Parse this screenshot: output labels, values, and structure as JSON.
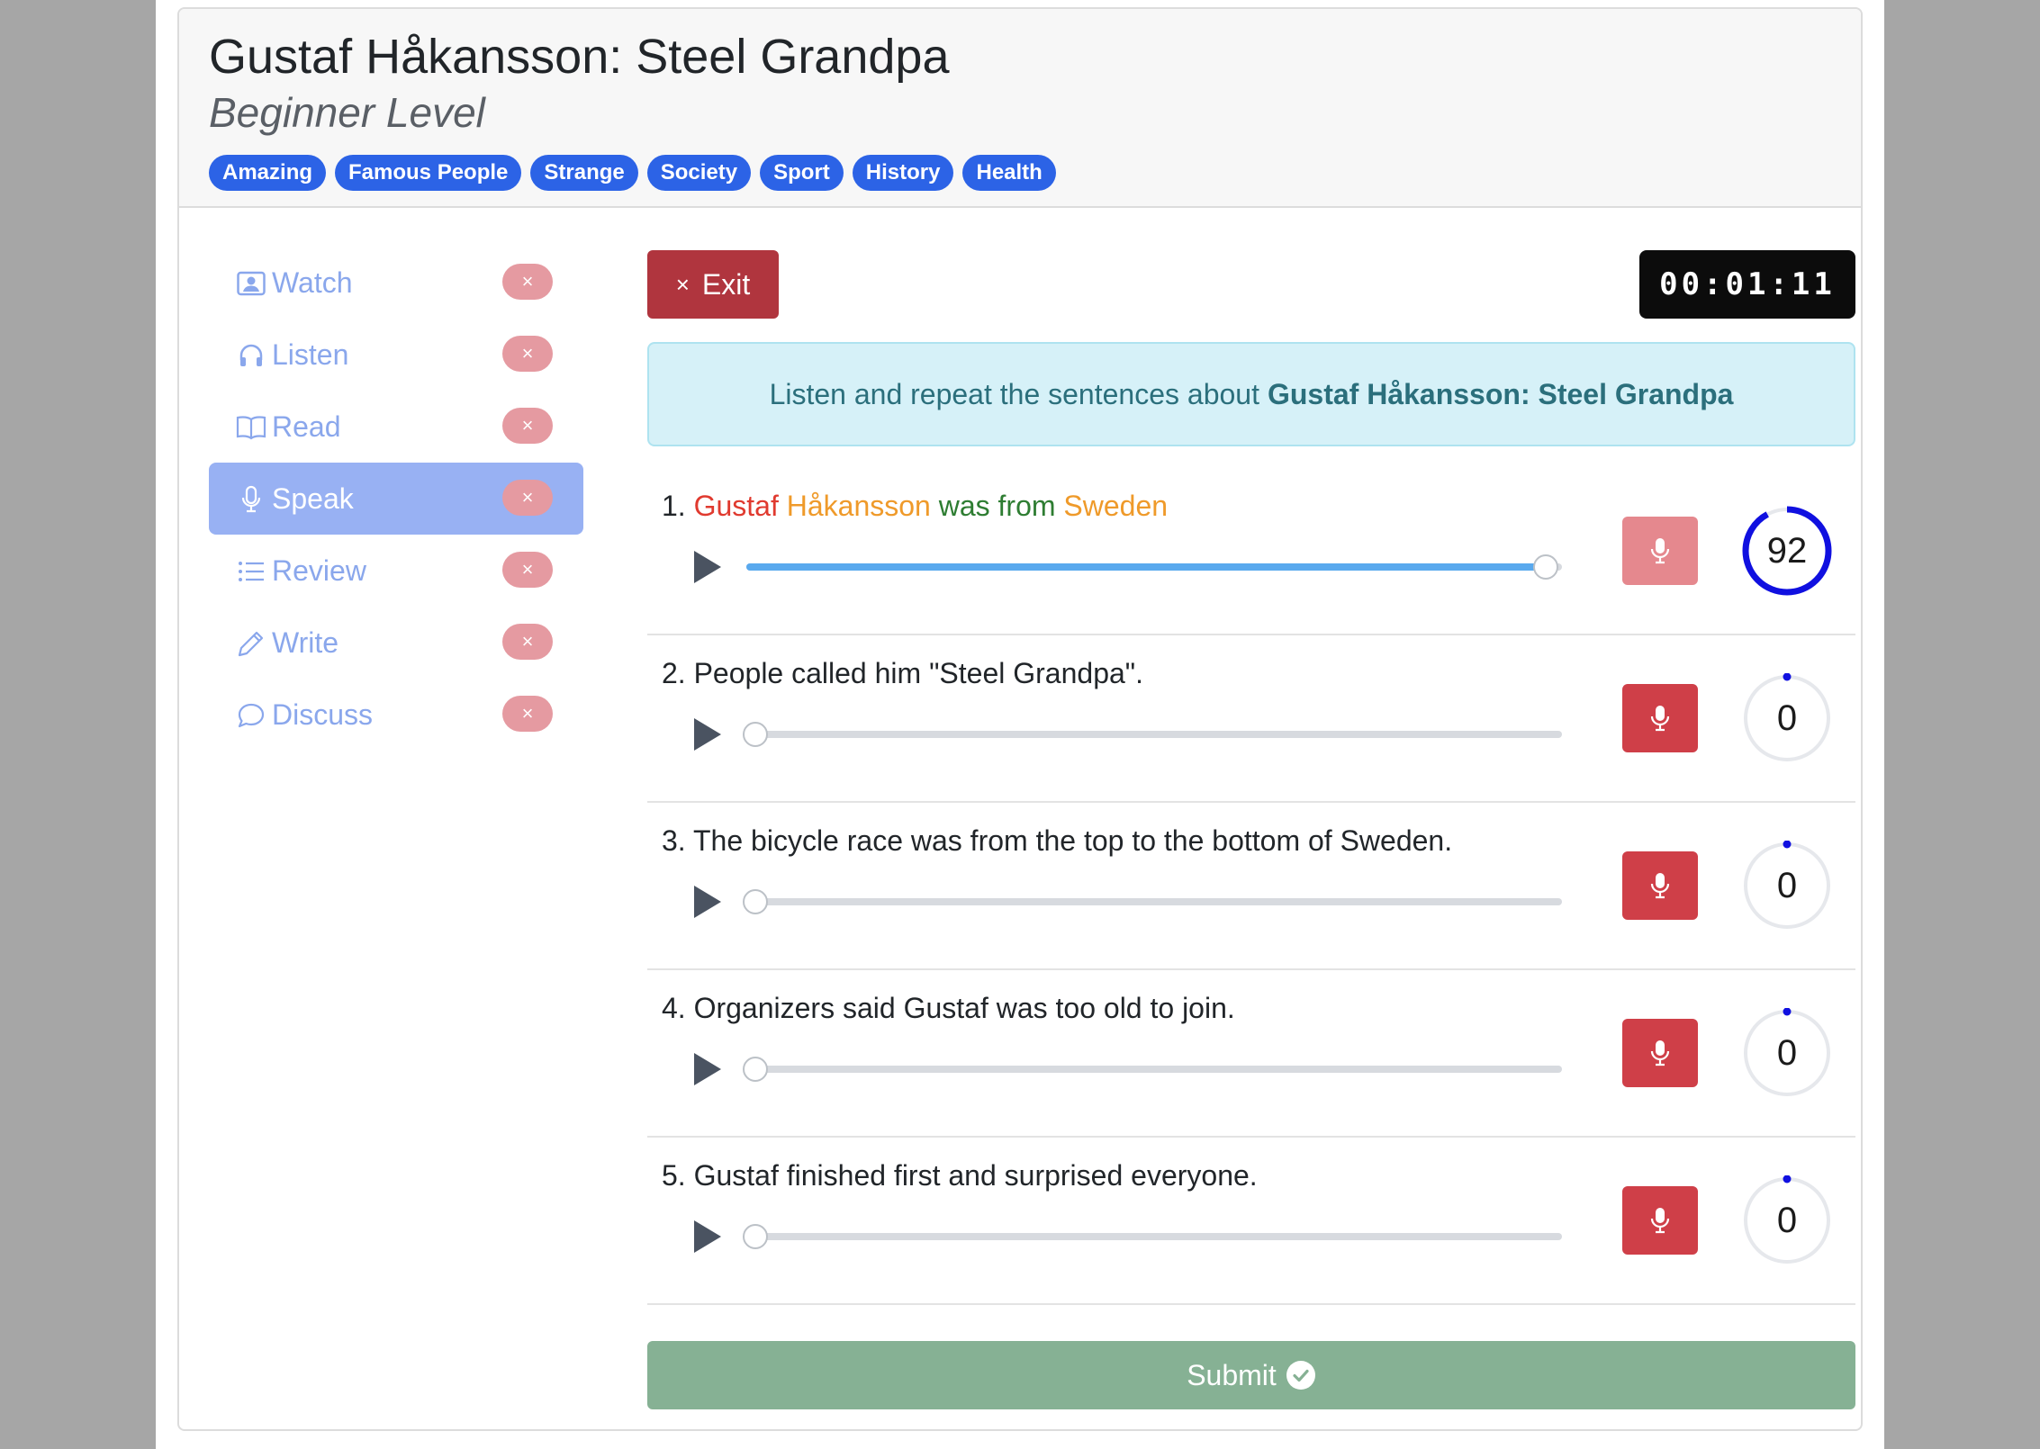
{
  "header": {
    "title": "Gustaf Håkansson: Steel Grandpa",
    "level": "Beginner Level",
    "tags": [
      "Amazing",
      "Famous People",
      "Strange",
      "Society",
      "Sport",
      "History",
      "Health"
    ]
  },
  "sidebar": {
    "items": [
      {
        "label": "Watch",
        "icon": "person-video-icon",
        "badge": "×",
        "active": false
      },
      {
        "label": "Listen",
        "icon": "headphones-icon",
        "badge": "×",
        "active": false
      },
      {
        "label": "Read",
        "icon": "book-icon",
        "badge": "×",
        "active": false
      },
      {
        "label": "Speak",
        "icon": "microphone-icon",
        "badge": "×",
        "active": true
      },
      {
        "label": "Review",
        "icon": "list-icon",
        "badge": "×",
        "active": false
      },
      {
        "label": "Write",
        "icon": "pencil-icon",
        "badge": "×",
        "active": false
      },
      {
        "label": "Discuss",
        "icon": "chat-bubble-icon",
        "badge": "×",
        "active": false
      }
    ]
  },
  "toolbar": {
    "exit_icon": "×",
    "exit_label": "Exit",
    "timer": "00:01:11"
  },
  "instruction": {
    "text": "Listen and repeat the sentences about",
    "topic": "Gustaf Håkansson: Steel Grandpa"
  },
  "sentences": [
    {
      "number": "1.",
      "words": [
        {
          "text": "Gustaf",
          "color": "#e03a2f"
        },
        {
          "text": "Håkansson",
          "color": "#ef9a2a"
        },
        {
          "text": "was",
          "color": "#2e7d32"
        },
        {
          "text": "from",
          "color": "#2e7d32"
        },
        {
          "text": "Sweden",
          "color": "#ef9a2a"
        }
      ],
      "progress": 1.0,
      "score": "92",
      "score_fraction": 0.92,
      "mic_disabled": true
    },
    {
      "number": "2.",
      "text": "People called him \"Steel Grandpa\".",
      "progress": 0,
      "score": "0",
      "score_fraction": 0,
      "mic_disabled": false
    },
    {
      "number": "3.",
      "text": "The bicycle race was from the top to the bottom of Sweden.",
      "progress": 0,
      "score": "0",
      "score_fraction": 0,
      "mic_disabled": false
    },
    {
      "number": "4.",
      "text": "Organizers said Gustaf was too old to join.",
      "progress": 0,
      "score": "0",
      "score_fraction": 0,
      "mic_disabled": false
    },
    {
      "number": "5.",
      "text": "Gustaf finished first and surprised everyone.",
      "progress": 0,
      "score": "0",
      "score_fraction": 0,
      "mic_disabled": false
    }
  ],
  "submit": {
    "label": "Submit",
    "icon": "check-circle-icon"
  },
  "colors": {
    "tag": "#2c63e6",
    "active_nav": "#98b1f3",
    "exit": "#b0353e",
    "mic": "#cf3f48",
    "score_ring": "#1010e0",
    "submit": "#86b194",
    "alert_bg": "#d6f1f8"
  }
}
